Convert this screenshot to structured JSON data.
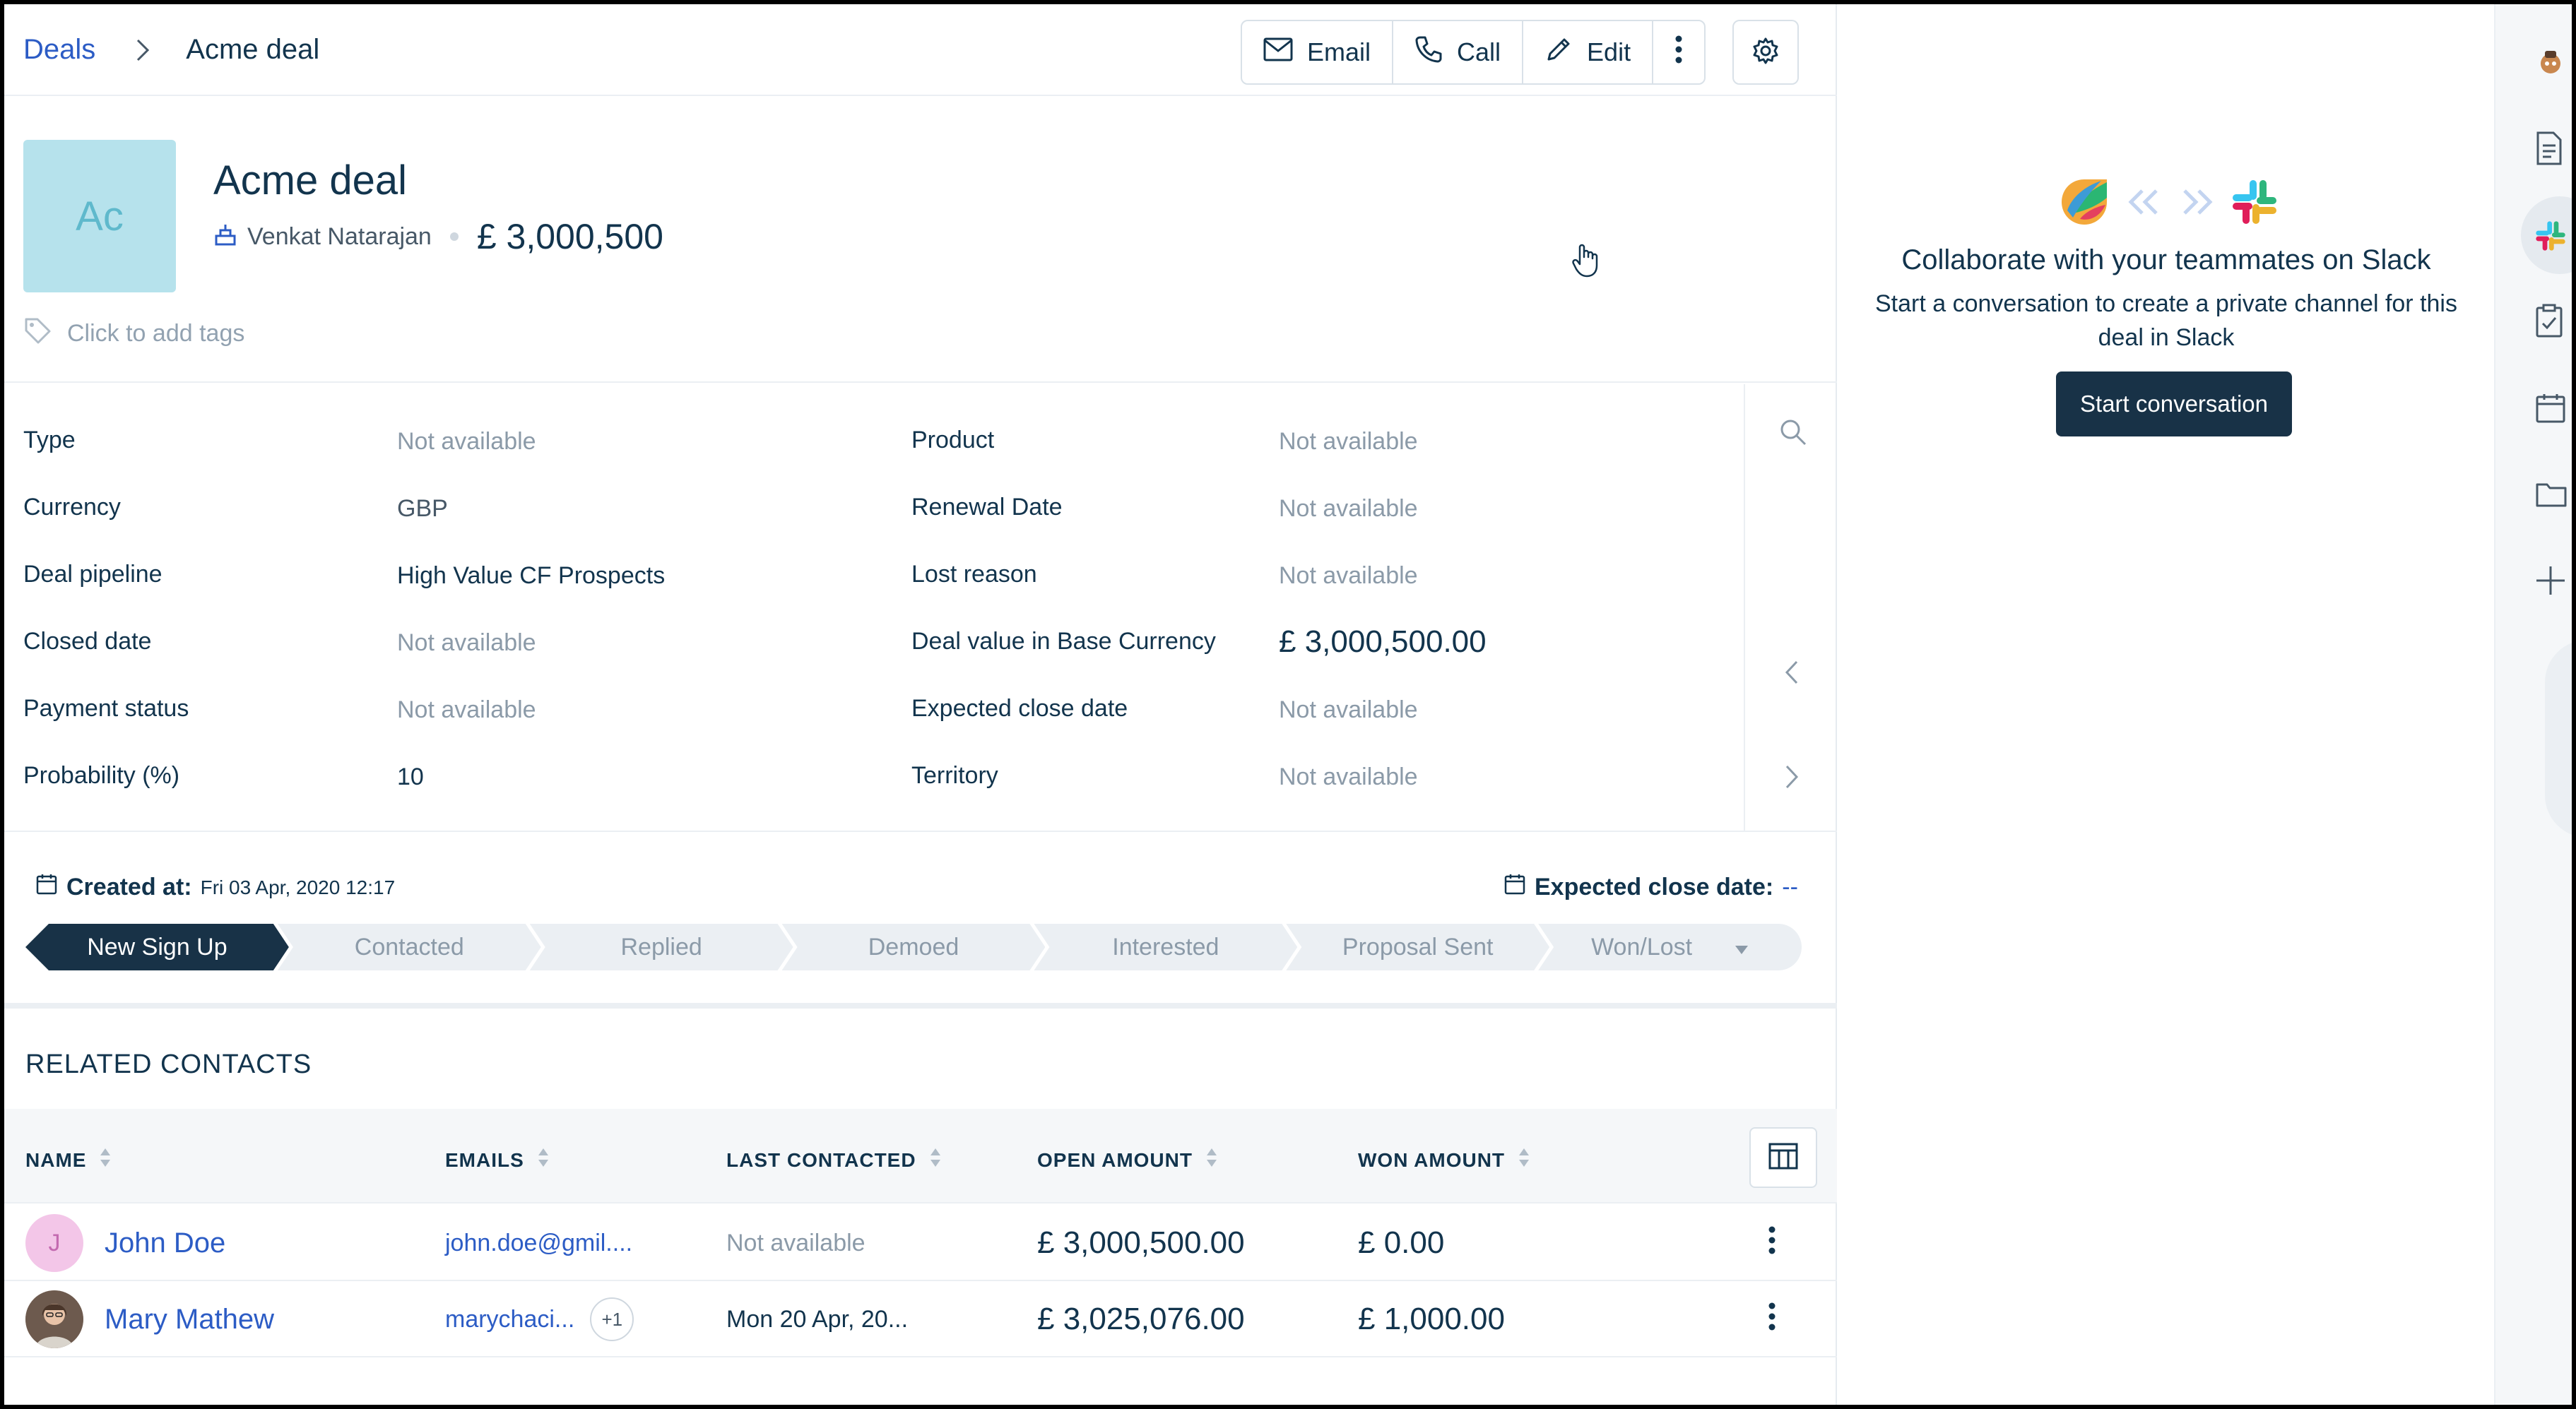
{
  "breadcrumb": {
    "root": "Deals",
    "current": "Acme deal"
  },
  "actions": {
    "email": "Email",
    "call": "Call",
    "edit": "Edit"
  },
  "deal": {
    "avatar_initials": "Ac",
    "title": "Acme deal",
    "owner": "Venkat Natarajan",
    "amount": "£ 3,000,500",
    "tags_placeholder": "Click to add tags"
  },
  "fields_left": [
    {
      "label": "Type",
      "value": "Not available"
    },
    {
      "label": "Currency",
      "value": "GBP"
    },
    {
      "label": "Deal pipeline",
      "value": "High Value CF Prospects"
    },
    {
      "label": "Closed date",
      "value": "Not available"
    },
    {
      "label": "Payment status",
      "value": "Not available"
    },
    {
      "label": "Probability (%)",
      "value": "10"
    }
  ],
  "fields_right": [
    {
      "label": "Product",
      "value": "Not available"
    },
    {
      "label": "Renewal Date",
      "value": "Not available"
    },
    {
      "label": "Lost reason",
      "value": "Not available"
    },
    {
      "label": "Deal value in Base Currency",
      "value": "£ 3,000,500.00"
    },
    {
      "label": "Expected close date",
      "value": "Not available"
    },
    {
      "label": "Territory",
      "value": "Not available"
    }
  ],
  "pipeline": {
    "created_label": "Created at:",
    "created_value": "Fri 03 Apr, 2020 12:17",
    "expected_label": "Expected close date:",
    "expected_value": "--",
    "stages": [
      "New Sign Up",
      "Contacted",
      "Replied",
      "Demoed",
      "Interested",
      "Proposal Sent",
      "Won/Lost"
    ],
    "active_stage": "New Sign Up"
  },
  "related": {
    "title": "RELATED CONTACTS",
    "columns": [
      "NAME",
      "EMAILS",
      "LAST CONTACTED",
      "OPEN AMOUNT",
      "WON AMOUNT"
    ],
    "rows": [
      {
        "initial": "J",
        "name": "John Doe",
        "email": "john.doe@gmil....",
        "extra_emails": "",
        "last_contacted": "Not available",
        "open_amount": "£ 3,000,500.00",
        "won_amount": "£ 0.00"
      },
      {
        "initial": "",
        "name": "Mary Mathew",
        "email": "marychaci...",
        "extra_emails": "+1",
        "last_contacted": "Mon 20 Apr, 20...",
        "open_amount": "£ 3,025,076.00",
        "won_amount": "£ 1,000.00"
      }
    ]
  },
  "slack": {
    "title": "Collaborate with your teammates on Slack",
    "description": "Start a conversation to create a private channel for this deal in Slack",
    "button": "Start conversation"
  },
  "colors": {
    "accent": "#2c5cc5",
    "dark": "#183247",
    "avatar_bg": "#b6e2ec"
  }
}
